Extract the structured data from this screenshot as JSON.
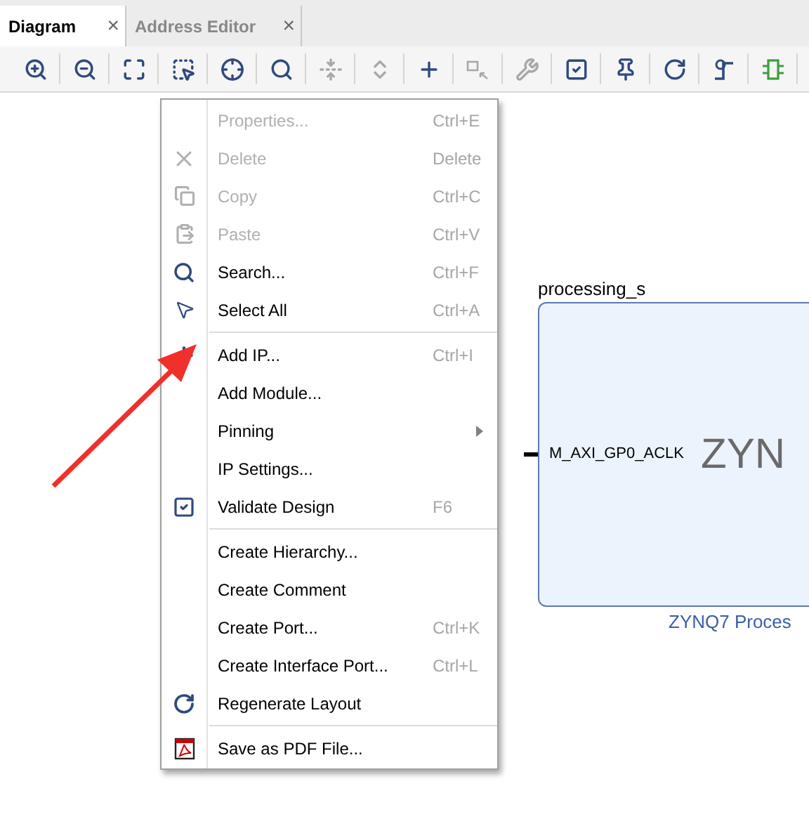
{
  "tabs": [
    {
      "label": "Diagram",
      "selected": true,
      "close": "×"
    },
    {
      "label": "Address Editor",
      "selected": false,
      "close": "×"
    }
  ],
  "toolbar": [
    {
      "kind": "zoom-in",
      "disabled": false
    },
    {
      "kind": "zoom-out",
      "disabled": false
    },
    {
      "kind": "fit",
      "disabled": false
    },
    {
      "kind": "select-area",
      "disabled": false
    },
    {
      "kind": "center",
      "disabled": false
    },
    {
      "kind": "search",
      "disabled": false
    },
    {
      "kind": "collapse",
      "disabled": true
    },
    {
      "kind": "expand",
      "disabled": true
    },
    {
      "kind": "add",
      "disabled": false
    },
    {
      "kind": "connect",
      "disabled": true
    },
    {
      "kind": "wrench",
      "disabled": true
    },
    {
      "kind": "validate",
      "disabled": false
    },
    {
      "kind": "pin",
      "disabled": false
    },
    {
      "kind": "refresh",
      "disabled": false
    },
    {
      "kind": "route",
      "disabled": false
    },
    {
      "kind": "module",
      "disabled": false
    }
  ],
  "context_menu": [
    [
      {
        "label": "Properties...",
        "shortcut": "Ctrl+E",
        "disabled": true,
        "kind": "none"
      },
      {
        "label": "Delete",
        "shortcut": "Delete",
        "disabled": true,
        "kind": "delete"
      },
      {
        "label": "Copy",
        "shortcut": "Ctrl+C",
        "disabled": true,
        "kind": "copy"
      },
      {
        "label": "Paste",
        "shortcut": "Ctrl+V",
        "disabled": true,
        "kind": "paste"
      },
      {
        "label": "Search...",
        "shortcut": "Ctrl+F",
        "disabled": false,
        "kind": "search"
      },
      {
        "label": "Select All",
        "shortcut": "Ctrl+A",
        "disabled": false,
        "kind": "select-all"
      }
    ],
    [
      {
        "label": "Add IP...",
        "shortcut": "Ctrl+I",
        "disabled": false,
        "kind": "add"
      },
      {
        "label": "Add Module...",
        "disabled": false,
        "kind": "none"
      },
      {
        "label": "Pinning",
        "disabled": false,
        "kind": "none",
        "submenu": true
      },
      {
        "label": "IP Settings...",
        "disabled": false,
        "kind": "none"
      },
      {
        "label": "Validate Design",
        "shortcut": "F6",
        "disabled": false,
        "kind": "validate"
      }
    ],
    [
      {
        "label": "Create Hierarchy...",
        "disabled": false,
        "kind": "none"
      },
      {
        "label": "Create Comment",
        "disabled": false,
        "kind": "none"
      },
      {
        "label": "Create Port...",
        "shortcut": "Ctrl+K",
        "disabled": false,
        "kind": "none"
      },
      {
        "label": "Create Interface Port...",
        "shortcut": "Ctrl+L",
        "disabled": false,
        "kind": "none"
      },
      {
        "label": "Regenerate Layout",
        "disabled": false,
        "kind": "refresh"
      }
    ],
    [
      {
        "label": "Save as PDF File...",
        "disabled": false,
        "kind": "pdf"
      }
    ]
  ],
  "block": {
    "name": "processing_s",
    "port": "M_AXI_GP0_ACLK",
    "logo": "ZYN",
    "subtitle": "ZYNQ7 Proces"
  }
}
